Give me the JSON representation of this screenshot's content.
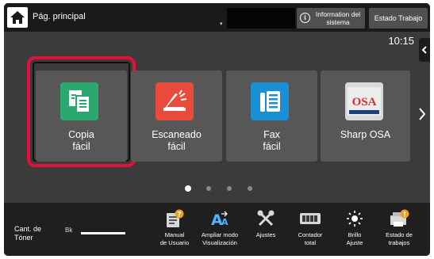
{
  "header": {
    "home_label": "Pág. principal",
    "info_label": "Information del sistema",
    "job_status_label": "Estado Trabajo",
    "clock": "10:15"
  },
  "tiles": [
    {
      "label": "Copia\nfácil",
      "icon": "copy-icon",
      "color": "#2aa86e"
    },
    {
      "label": "Escaneado\nfácil",
      "icon": "scan-icon",
      "color": "#e84a3b"
    },
    {
      "label": "Fax\nfácil",
      "icon": "fax-icon",
      "color": "#1a8fd6"
    },
    {
      "label": "Sharp OSA",
      "icon": "sharp-osa-icon",
      "color": "#d9d9d9",
      "logo_text": "OSA"
    }
  ],
  "pagination": {
    "page_count": 4,
    "active_index": 0
  },
  "toner": {
    "label": "Cant. de Tóner",
    "color": "Bk",
    "level_percent": 100
  },
  "bottom_tools": [
    {
      "label": "Manual\nde Usuario",
      "icon": "manual-icon"
    },
    {
      "label": "Ampliar modo\nVisualización",
      "icon": "enlarge-display-icon"
    },
    {
      "label": "Ajustes",
      "icon": "settings-tools-icon"
    },
    {
      "label": "Contador\ntotal",
      "icon": "counter-icon"
    },
    {
      "label": "Brillo\nAjuste",
      "icon": "brightness-icon"
    },
    {
      "label": "Estado de\ntrabajos",
      "icon": "job-status-icon"
    }
  ],
  "colors": {
    "selection_ring": "#e60f37",
    "badge_orange": "#f0a020"
  }
}
